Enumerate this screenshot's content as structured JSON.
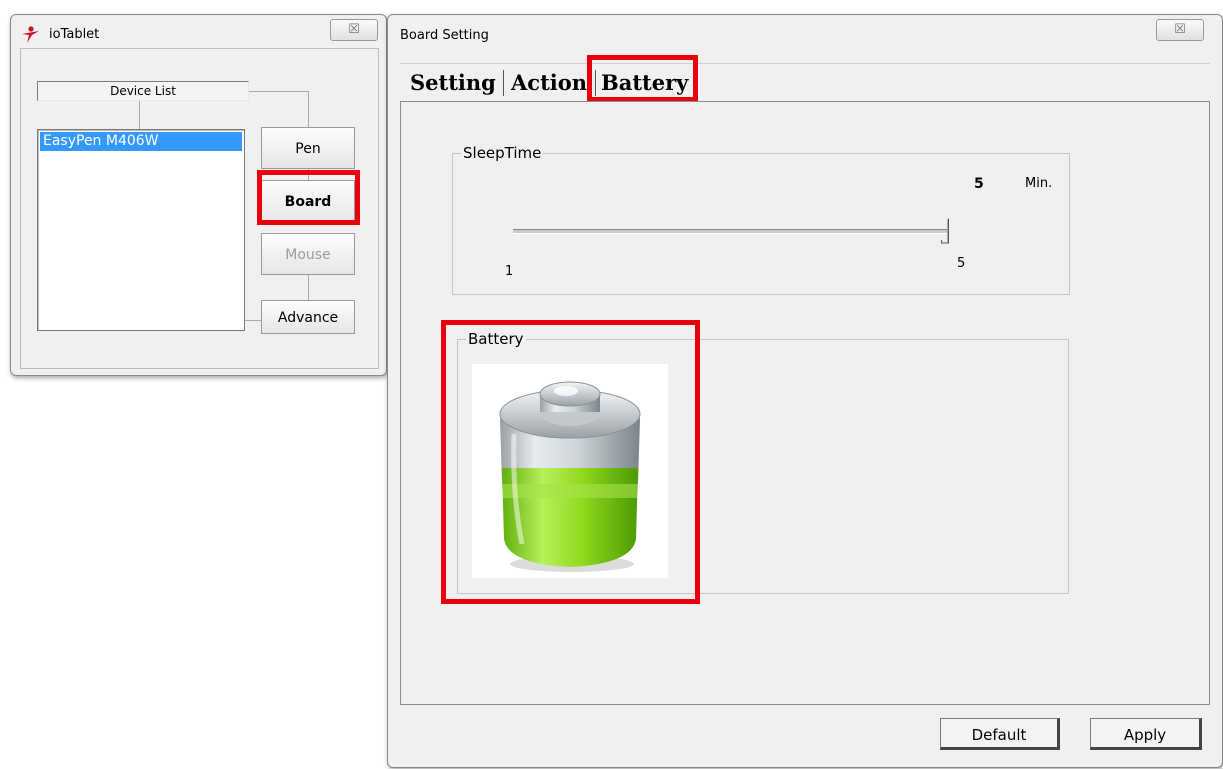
{
  "left_window": {
    "title": "ioTablet",
    "close_glyph": "☒",
    "device_list_header": "Device List",
    "devices": [
      "EasyPen M406W"
    ],
    "buttons": {
      "pen": "Pen",
      "board": "Board",
      "mouse": "Mouse",
      "advance": "Advance"
    }
  },
  "board_window": {
    "title": "Board Setting",
    "close_glyph": "☒",
    "tabs": [
      {
        "label": "Setting"
      },
      {
        "label": "Action"
      },
      {
        "label": "Battery",
        "selected": true
      }
    ],
    "sleep_time": {
      "label": "SleepTime",
      "value": "5",
      "unit": "Min.",
      "min_label": "1",
      "max_label": "5",
      "min": 1,
      "max": 5,
      "current": 5
    },
    "battery": {
      "label": "Battery",
      "icon": "battery-charge-icon",
      "level_fraction": 0.55,
      "fill_color": "#8ed81c"
    },
    "footer": {
      "default_label": "Default",
      "apply_label": "Apply"
    }
  },
  "colors": {
    "highlight": "#e8000d",
    "selection": "#3399ff"
  }
}
